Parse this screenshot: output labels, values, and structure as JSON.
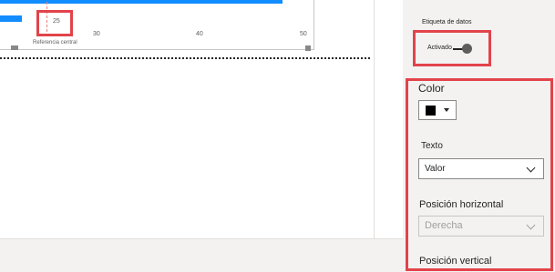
{
  "chart": {
    "ticks": [
      "25",
      "30",
      "40",
      "50"
    ],
    "reference_caption": "Referencia central"
  },
  "format_pane": {
    "data_labels": {
      "label": "Etiqueta de datos",
      "toggle_state": "Activado"
    },
    "color": {
      "title": "Color",
      "swatch_color": "#000000"
    },
    "texto": {
      "label": "Texto",
      "value": "Valor"
    },
    "posicion_horizontal": {
      "label": "Posición horizontal",
      "value": "Derecha"
    },
    "posicion_vertical": {
      "label": "Posición vertical"
    }
  },
  "colors": {
    "accent": "#118dff",
    "highlight": "#e2434b",
    "pane_bg": "#f3f2f1"
  }
}
